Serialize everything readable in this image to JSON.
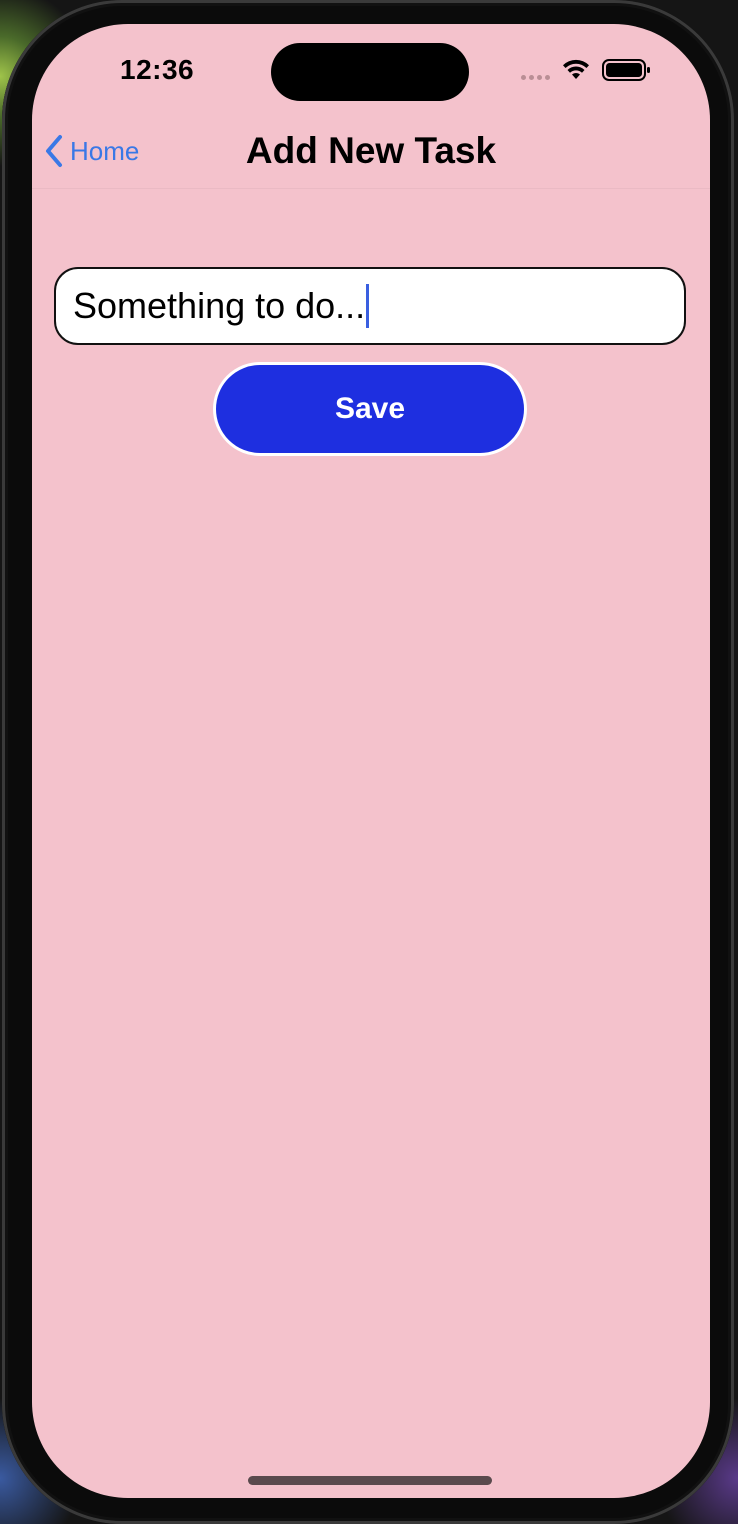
{
  "status_bar": {
    "time": "12:36"
  },
  "nav": {
    "back_label": "Home",
    "title": "Add New Task"
  },
  "task_input": {
    "value": "Something to do..."
  },
  "save_button": {
    "label": "Save"
  },
  "colors": {
    "background": "#f4c2cc",
    "accent": "#1e2fe0",
    "link": "#3a78e6"
  },
  "icons": [
    "chevron-left-icon",
    "wifi-icon",
    "battery-icon",
    "cellular-icon"
  ]
}
